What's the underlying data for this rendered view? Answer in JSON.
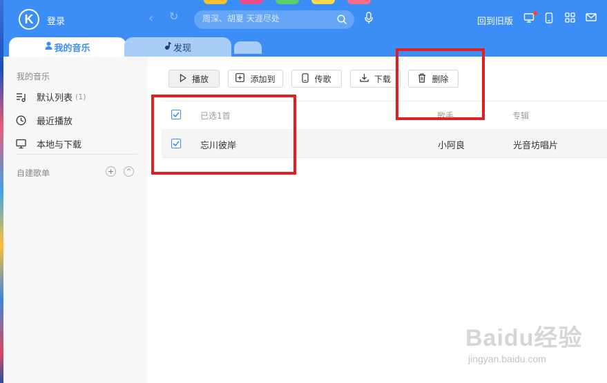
{
  "app": {
    "logo_letter": "K",
    "login_label": "登录",
    "old_version_label": "回到旧版",
    "accent": "#3c8df5"
  },
  "search": {
    "placeholder": "周深、胡夏 天涯尽处"
  },
  "tabs": [
    {
      "label": "我的音乐",
      "icon": "person-icon",
      "active": true
    },
    {
      "label": "发现",
      "icon": "music-note-icon",
      "active": false
    }
  ],
  "sidebar": {
    "section_title": "我的音乐",
    "items": [
      {
        "label": "默认列表",
        "count": "(1)",
        "icon": "playlist-icon"
      },
      {
        "label": "最近播放",
        "icon": "clock-icon"
      },
      {
        "label": "本地与下载",
        "icon": "monitor-icon"
      }
    ],
    "custom_section": "自建歌单",
    "add_symbol": "+",
    "collapse_symbol": "^"
  },
  "toolbar": {
    "play_label": "播放",
    "add_to_label": "添加到",
    "transfer_label": "传歌",
    "download_label": "下载",
    "delete_label": "删除"
  },
  "table": {
    "selected_label": "已选1首",
    "col_singer": "歌手",
    "col_album": "专辑",
    "rows": [
      {
        "title": "忘川彼岸",
        "singer": "小阿良",
        "album": "光音坊唱片",
        "checked": true
      }
    ]
  },
  "watermark": {
    "main": "Baidu经验",
    "sub": "jingyan.baidu.com"
  }
}
